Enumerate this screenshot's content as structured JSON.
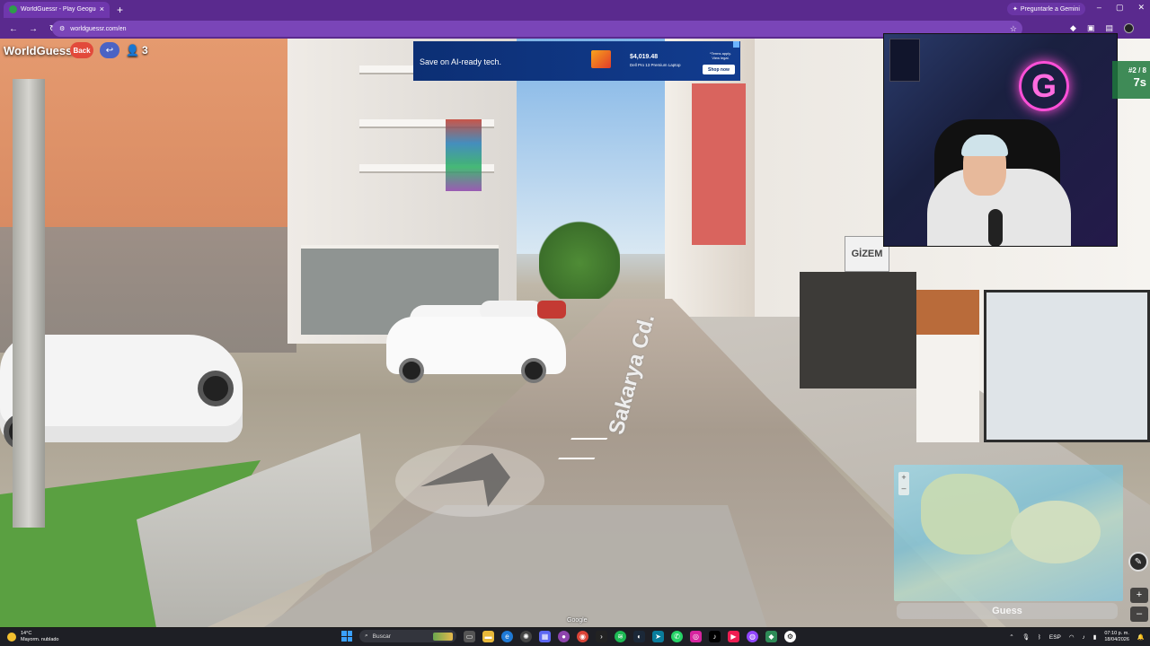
{
  "browser": {
    "tab_title": "WorldGuessr - Play Geoguessr",
    "tab_close": "×",
    "new_tab": "+",
    "url": "worldguessr.com/en",
    "gemini_label": "Preguntarle a Gemini",
    "window_controls": [
      "–",
      "▢",
      "✕"
    ]
  },
  "game": {
    "brand": "WorldGuessr",
    "back_label": "Back",
    "player_count": "3",
    "round": "#2 / 8",
    "timer": "7s",
    "guess_label": "Guess",
    "street_name": "Sakarya Cd.",
    "google_attribution": "Google",
    "storefront_sign": "GİZEM"
  },
  "ad": {
    "headline": "Save on AI-ready tech.",
    "price": "$4,019.48",
    "product": "Dell Pro 13 Premium Laptop",
    "terms": "*Terms apply. View legal.",
    "cta": "Shop now"
  },
  "webcam": {
    "neon_letter": "G"
  },
  "taskbar": {
    "temperature": "14°C",
    "weather": "Mayorm. nublado",
    "search_placeholder": "Buscar",
    "language": "ESP",
    "time": "07:10 p. m.",
    "date": "18/04/2026"
  },
  "icons": {
    "back_nav": "arrow-left-icon",
    "forward_nav": "arrow-right-icon",
    "reload": "reload-icon",
    "share": "share-icon",
    "user": "user-icon",
    "star": "star-icon"
  }
}
